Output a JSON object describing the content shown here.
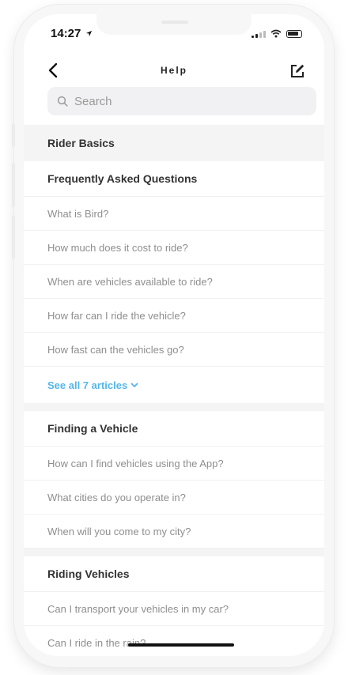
{
  "status_bar": {
    "time": "14:27"
  },
  "navbar": {
    "title": "Help",
    "back_icon": "chevron-left-icon",
    "compose_icon": "compose-icon"
  },
  "search": {
    "placeholder": "Search",
    "value": ""
  },
  "colors": {
    "link": "#54b6ee",
    "section_bg": "#f4f4f5",
    "muted_text": "#8e8e8e"
  },
  "sections": {
    "rider_basics": {
      "header": "Rider Basics",
      "group_title": "Frequently Asked Questions",
      "items": [
        "What is Bird?",
        "How much does it cost to ride?",
        "When are vehicles available to ride?",
        "How far can I ride the vehicle?",
        "How fast can the vehicles go?"
      ],
      "see_all": "See all 7 articles"
    },
    "finding_vehicle": {
      "group_title": "Finding a Vehicle",
      "items": [
        "How can I find vehicles using the App?",
        "What cities do you operate in?",
        "When will you come to my city?"
      ]
    },
    "riding_vehicles": {
      "group_title": "Riding Vehicles",
      "items": [
        "Can I transport your vehicles in my car?",
        "Can I ride in the rain?"
      ]
    }
  }
}
